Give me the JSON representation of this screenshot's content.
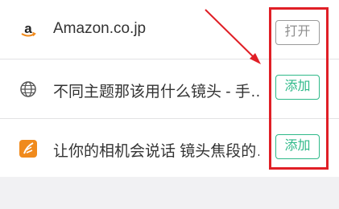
{
  "items": [
    {
      "title": "Amazon.co.jp",
      "button": "打开",
      "icon": "amazon-icon"
    },
    {
      "title": "不同主题那该用什么镜头 - 手…",
      "button": "添加",
      "icon": "globe-icon"
    },
    {
      "title": "让你的相机会说话 镜头焦段的…",
      "button": "添加",
      "icon": "feather-app-icon"
    }
  ],
  "colors": {
    "add_button": "#2fb989",
    "open_button": "#9a9a9a",
    "annotation": "#e01f26",
    "amazon_orange": "#f08a1c"
  }
}
